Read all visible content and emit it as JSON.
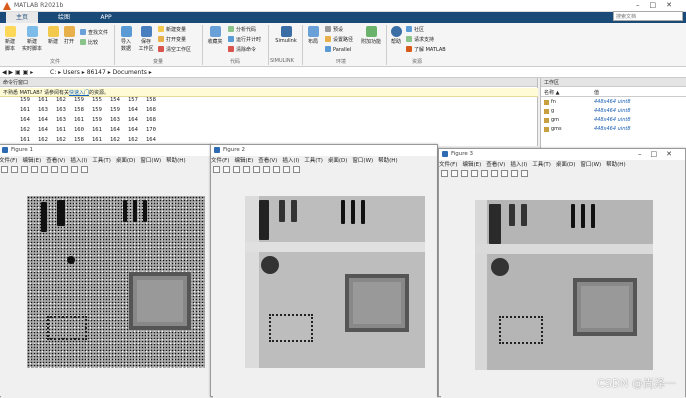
{
  "app_title": "MATLAB R2021b",
  "search_placeholder": "搜索文档",
  "tabs": [
    "主页",
    "绘图",
    "APP"
  ],
  "ribbon": {
    "new_script": "新建\n脚本",
    "new_live": "新建\n实时脚本",
    "new": "新建",
    "open": "打开",
    "find_files": "查找文件",
    "compare": "比较",
    "import_data": "导入\n数据",
    "save_workspace": "保存\n工作区",
    "new_variable": "新建变量",
    "open_variable": "打开变量",
    "clear_workspace": "清空工作区",
    "favorites": "收藏夹",
    "analyze_code": "分析代码",
    "run_and_time": "运行并计时",
    "clear_commands": "清除命令",
    "simulink": "Simulink",
    "layout": "布局",
    "preferences": "预设",
    "set_path": "设置路径",
    "parallel": "Parallel",
    "addons": "附加功能",
    "help": "帮助",
    "community": "社区",
    "request_support": "请求支持",
    "learn_matlab": "了解 MATLAB",
    "groups": [
      "文件",
      "变量",
      "代码",
      "SIMULINK",
      "环境",
      "资源"
    ]
  },
  "address": [
    "C:",
    "Users",
    "86147",
    "Documents"
  ],
  "command_window": {
    "header": "命令行窗口",
    "notice_text": "不熟悉 MATLAB? 请参阅有关",
    "notice_link": "快速入门",
    "notice_tail": "的资源。",
    "rows": [
      [
        "159",
        "161",
        "162",
        "159",
        "155",
        "154",
        "157",
        "158"
      ],
      [
        "161",
        "163",
        "163",
        "158",
        "159",
        "159",
        "164",
        "168"
      ],
      [
        "164",
        "164",
        "163",
        "161",
        "159",
        "163",
        "164",
        "168"
      ],
      [
        "162",
        "164",
        "161",
        "160",
        "161",
        "164",
        "164",
        "170"
      ],
      [
        "161",
        "162",
        "162",
        "158",
        "161",
        "162",
        "162",
        "164"
      ]
    ]
  },
  "workspace": {
    "header": "工作区",
    "col_name": "名称 ▲",
    "col_value": "值",
    "vars": [
      {
        "name": "fn",
        "value": "448x464 uint8"
      },
      {
        "name": "g",
        "value": "448x464 uint8"
      },
      {
        "name": "gm",
        "value": "448x464 uint8"
      },
      {
        "name": "gms",
        "value": "448x464 uint8"
      }
    ]
  },
  "figures": [
    {
      "title": "Figure 1"
    },
    {
      "title": "Figure 2"
    },
    {
      "title": "Figure 3"
    }
  ],
  "figure_menu": [
    "文件(F)",
    "编辑(E)",
    "查看(V)",
    "插入(I)",
    "工具(T)",
    "桌面(D)",
    "窗口(W)",
    "帮助(H)"
  ],
  "watermark": "CSDN @尚泽一",
  "colors": {
    "tab_bar": "#1a4a78",
    "link": "#1565c0",
    "matlab_logo": "#d85a1a"
  }
}
